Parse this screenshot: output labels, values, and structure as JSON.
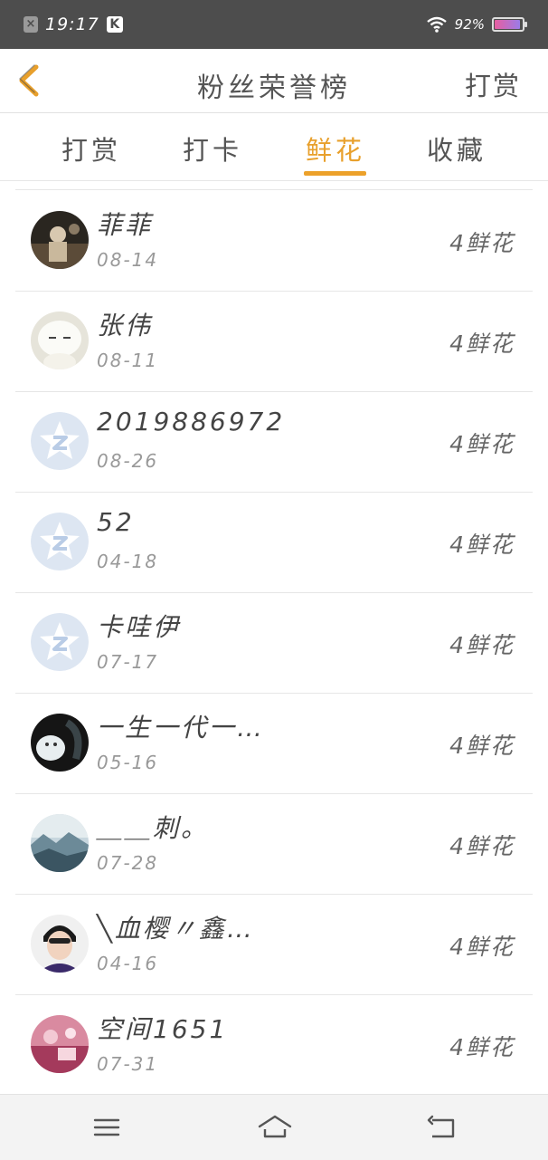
{
  "status_bar": {
    "time": "19:17",
    "battery": "92%",
    "battery_fraction": 0.92,
    "icons": [
      "notification-close-icon",
      "k-app-icon",
      "wifi-icon",
      "battery-icon"
    ]
  },
  "header": {
    "title": "粉丝荣誉榜",
    "right_action": "打赏",
    "back_icon": "chevron-left-icon",
    "accent_color": "#e8a02c"
  },
  "tabs": [
    {
      "label": "打赏",
      "active": false
    },
    {
      "label": "打卡",
      "active": false
    },
    {
      "label": "鲜花",
      "active": true
    },
    {
      "label": "收藏",
      "active": false
    }
  ],
  "fans": [
    {
      "name": "菲菲",
      "date": "08-14",
      "gift": "4鲜花",
      "avatar": "photo"
    },
    {
      "name": "张伟",
      "date": "08-11",
      "gift": "4鲜花",
      "avatar": "photo"
    },
    {
      "name": "2019886972",
      "date": "08-26",
      "gift": "4鲜花",
      "avatar": "default-qq"
    },
    {
      "name": "52",
      "date": "04-18",
      "gift": "4鲜花",
      "avatar": "default-qq"
    },
    {
      "name": "卡哇伊",
      "date": "07-17",
      "gift": "4鲜花",
      "avatar": "default-qq"
    },
    {
      "name": "一生一代一…",
      "date": "05-16",
      "gift": "4鲜花",
      "avatar": "photo"
    },
    {
      "name": "＿＿刺。",
      "date": "07-28",
      "gift": "4鲜花",
      "avatar": "photo"
    },
    {
      "name": "╲血樱〃鑫…",
      "date": "04-16",
      "gift": "4鲜花",
      "avatar": "photo"
    },
    {
      "name": "空间1651",
      "date": "07-31",
      "gift": "4鲜花",
      "avatar": "photo"
    }
  ],
  "nav_bar": {
    "icons": [
      "menu-icon",
      "home-icon",
      "back-icon"
    ]
  }
}
